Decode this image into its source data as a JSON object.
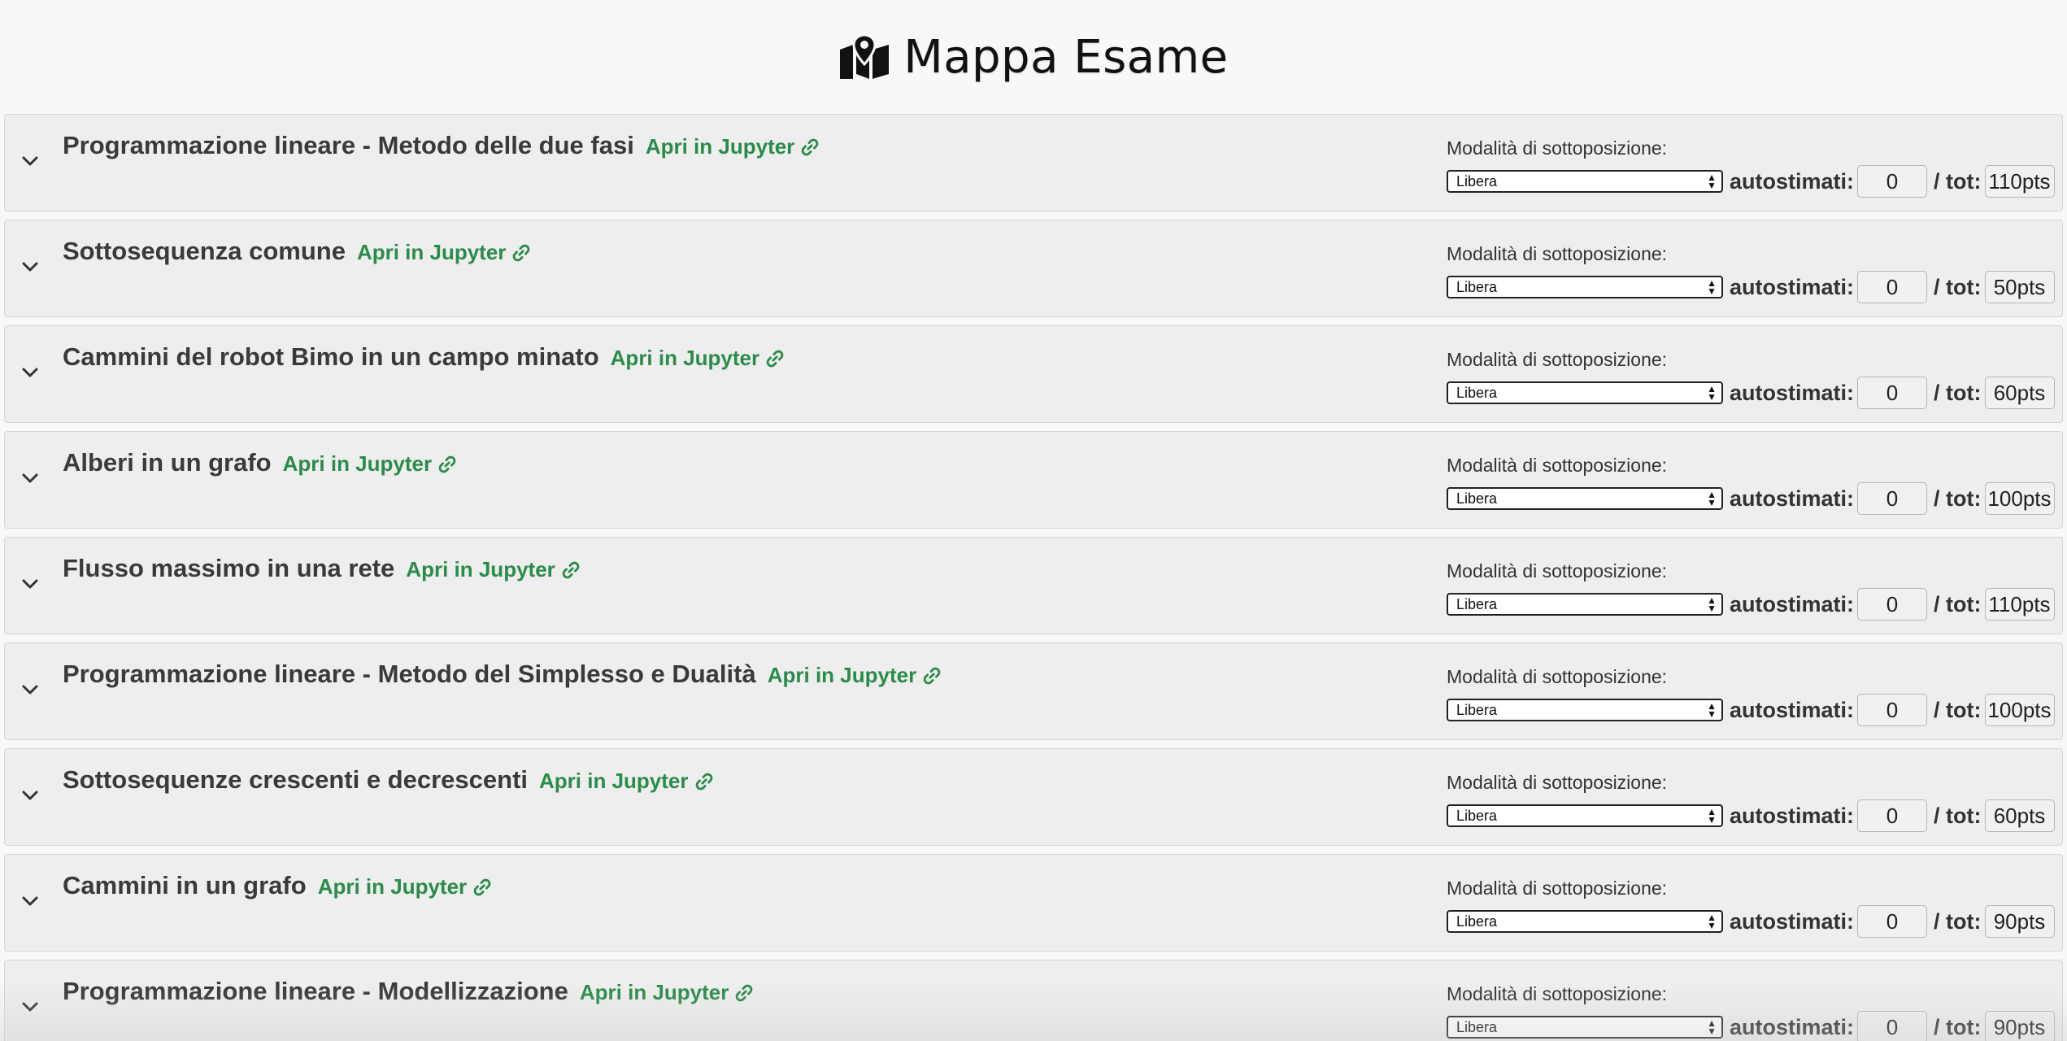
{
  "header": {
    "title": "Mappa Esame",
    "icon": "map-marker-icon"
  },
  "common": {
    "mode_label": "Modalità di sottoposizione:",
    "mode_value": "Libera",
    "jupyter_label": "Apri in Jupyter",
    "estimated_label": "autostimati:",
    "total_label": "/ tot:"
  },
  "tasks": [
    {
      "title": "Programmazione lineare - Metodo delle due fasi",
      "estimated": "0",
      "total": "110pts"
    },
    {
      "title": "Sottosequenza comune",
      "estimated": "0",
      "total": "50pts"
    },
    {
      "title": "Cammini del robot Bimo in un campo minato",
      "estimated": "0",
      "total": "60pts"
    },
    {
      "title": "Alberi in un grafo",
      "estimated": "0",
      "total": "100pts"
    },
    {
      "title": "Flusso massimo in una rete",
      "estimated": "0",
      "total": "110pts"
    },
    {
      "title": "Programmazione lineare - Metodo del Simplesso e Dualità",
      "estimated": "0",
      "total": "100pts"
    },
    {
      "title": "Sottosequenze crescenti e decrescenti",
      "estimated": "0",
      "total": "60pts"
    },
    {
      "title": "Cammini in un grafo",
      "estimated": "0",
      "total": "90pts"
    },
    {
      "title": "Programmazione lineare - Modellizzazione",
      "estimated": "0",
      "total": "90pts"
    }
  ],
  "colors": {
    "link": "#2a8c4a",
    "panel": "#eeeeee",
    "background": "#f8f8f8"
  }
}
